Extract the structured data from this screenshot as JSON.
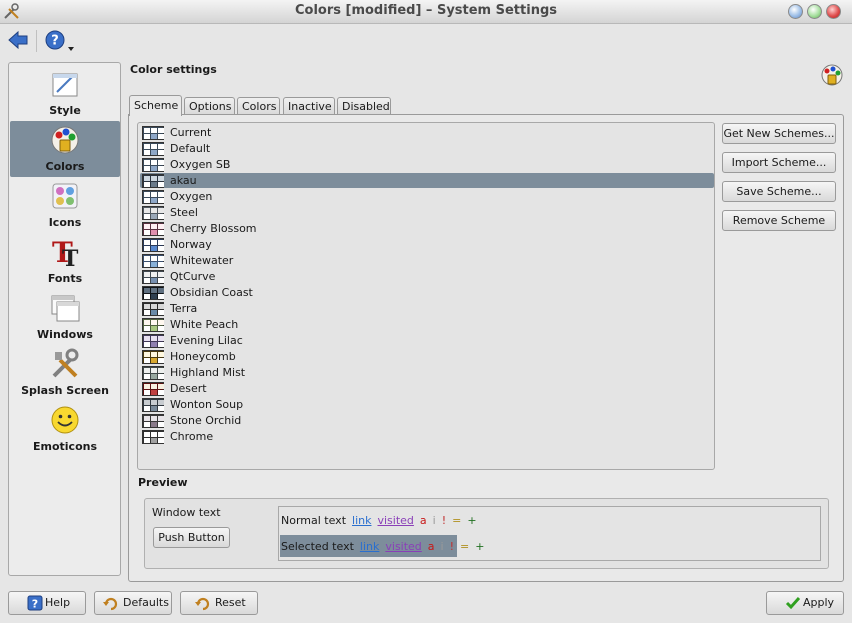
{
  "window": {
    "title": "Colors [modified] – System Settings"
  },
  "toolbar": {
    "back_icon": "back-arrow-icon",
    "help_icon": "help-icon"
  },
  "sidebar": {
    "items": [
      {
        "label": "Style",
        "icon": "style-icon",
        "active": false
      },
      {
        "label": "Colors",
        "icon": "colors-icon",
        "active": true
      },
      {
        "label": "Icons",
        "icon": "icons-icon",
        "active": false
      },
      {
        "label": "Fonts",
        "icon": "fonts-icon",
        "active": false
      },
      {
        "label": "Windows",
        "icon": "windows-icon",
        "active": false
      },
      {
        "label": "Splash Screen",
        "icon": "splash-screen-icon",
        "active": false
      },
      {
        "label": "Emoticons",
        "icon": "emoticons-icon",
        "active": false
      }
    ]
  },
  "main": {
    "title": "Color settings",
    "tabs": [
      {
        "label": "Scheme",
        "active": true
      },
      {
        "label": "Options",
        "active": false
      },
      {
        "label": "Colors",
        "active": false
      },
      {
        "label": "Inactive",
        "active": false
      },
      {
        "label": "Disabled",
        "active": false
      }
    ],
    "schemes": [
      {
        "name": "Current",
        "colors": [
          "#3a4a5a",
          "#8fa8c8",
          "#ffffff"
        ]
      },
      {
        "name": "Default",
        "colors": [
          "#3a4a5a",
          "#8fa8c8",
          "#ffffff"
        ]
      },
      {
        "name": "Oxygen SB",
        "colors": [
          "#3a4a5a",
          "#8fa8c8",
          "#ffffff"
        ]
      },
      {
        "name": "akau",
        "colors": [
          "#2a3440",
          "#6a7a8a",
          "#cfd8e0"
        ]
      },
      {
        "name": "Oxygen",
        "colors": [
          "#3a4a5a",
          "#8fa8c8",
          "#ffffff"
        ]
      },
      {
        "name": "Steel",
        "colors": [
          "#505860",
          "#9aa8b8",
          "#e8e8e8"
        ]
      },
      {
        "name": "Cherry Blossom",
        "colors": [
          "#5a3040",
          "#e090b0",
          "#fff0f4"
        ]
      },
      {
        "name": "Norway",
        "colors": [
          "#2a3a5a",
          "#5a8ad0",
          "#ffffff"
        ]
      },
      {
        "name": "Whitewater",
        "colors": [
          "#3a5070",
          "#88b0d8",
          "#ffffff"
        ]
      },
      {
        "name": "QtCurve",
        "colors": [
          "#404850",
          "#7890b0",
          "#f0f0f0"
        ]
      },
      {
        "name": "Obsidian Coast",
        "colors": [
          "#101418",
          "#304050",
          "#607080"
        ]
      },
      {
        "name": "Terra",
        "colors": [
          "#2a2a2a",
          "#6a8aa8",
          "#d8d8d8"
        ]
      },
      {
        "name": "White Peach",
        "colors": [
          "#506040",
          "#a8c880",
          "#fff8f0"
        ]
      },
      {
        "name": "Evening Lilac",
        "colors": [
          "#403858",
          "#9080b0",
          "#e8e0f0"
        ]
      },
      {
        "name": "Honeycomb",
        "colors": [
          "#4a3a10",
          "#d8a830",
          "#fff8e0"
        ]
      },
      {
        "name": "Highland Mist",
        "colors": [
          "#404848",
          "#98a8a0",
          "#eef0ee"
        ]
      },
      {
        "name": "Desert",
        "colors": [
          "#5a1010",
          "#c04040",
          "#f8f0e0"
        ]
      },
      {
        "name": "Wonton Soup",
        "colors": [
          "#303840",
          "#7a8a9a",
          "#c8ccd0"
        ]
      },
      {
        "name": "Stone Orchid",
        "colors": [
          "#383838",
          "#8a7a8a",
          "#e8e4e8"
        ]
      },
      {
        "name": "Chrome",
        "colors": [
          "#303030",
          "#a0a0a0",
          "#ffffff"
        ]
      }
    ],
    "selected_scheme": "akau",
    "buttons": {
      "get_new": "Get New Schemes...",
      "import": "Import Scheme...",
      "save": "Save Scheme...",
      "remove": "Remove Scheme"
    },
    "preview": {
      "title": "Preview",
      "window_text": "Window text",
      "push_button": "Push Button",
      "normal": {
        "text": "Normal text",
        "link": "link",
        "visited": "visited",
        "active": "a",
        "inactive": "i",
        "negative": "!",
        "neutral": "=",
        "positive": "+"
      },
      "selected": {
        "text": "Selected text",
        "link": "link",
        "visited": "visited",
        "active": "a",
        "inactive": "i",
        "negative": "!",
        "neutral": "=",
        "positive": "+"
      }
    }
  },
  "footer": {
    "help": "Help",
    "defaults": "Defaults",
    "reset": "Reset",
    "apply": "Apply"
  }
}
